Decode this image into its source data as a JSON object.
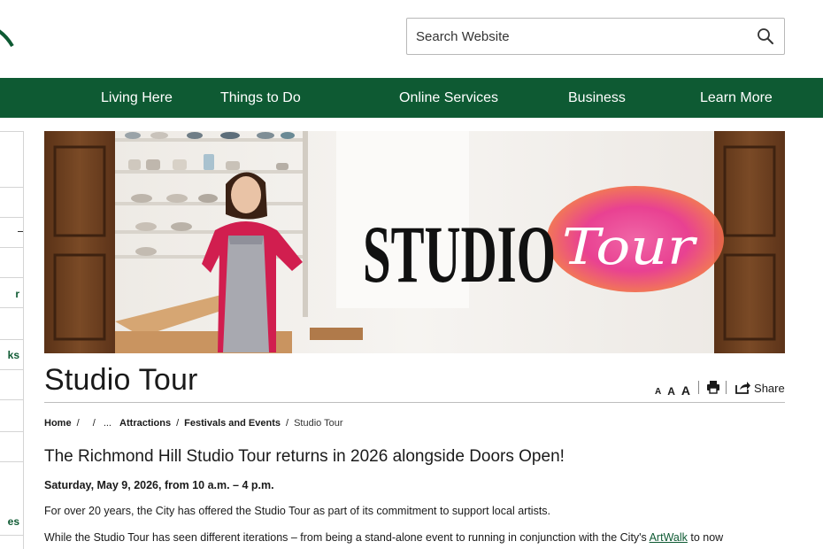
{
  "search": {
    "placeholder": "Search Website"
  },
  "nav": {
    "items": [
      {
        "label": "Living Here"
      },
      {
        "label": "Things to Do"
      },
      {
        "label": "Online Services"
      },
      {
        "label": "Business"
      },
      {
        "label": "Learn More"
      }
    ]
  },
  "sidebar": {
    "fragments": [
      "r",
      "ks",
      "es"
    ]
  },
  "hero": {
    "text_studio": "STUDIO",
    "text_tour": "Tour"
  },
  "page": {
    "title": "Studio Tour"
  },
  "tools": {
    "font_small": "A",
    "font_medium": "A",
    "font_large": "A",
    "share_label": "Share"
  },
  "breadcrumb": {
    "home": "Home",
    "sep": "/",
    "ellipsis": "...",
    "attractions": "Attractions",
    "festivals": "Festivals and Events",
    "current": "Studio Tour"
  },
  "content": {
    "heading": "The Richmond Hill Studio Tour returns in 2026 alongside Doors Open!",
    "date": "Saturday, May 9, 2026, from 10 a.m. – 4 p.m.",
    "para1": "For over 20 years, the City has offered the Studio Tour as part of its commitment to support local artists.",
    "para2_start": "While the Studio Tour has seen different iterations – from being a stand-alone event to running in conjunction with the City's ",
    "para2_link": "ArtWalk",
    "para2_end": " to now"
  },
  "colors": {
    "brand_green": "#0e5a33",
    "hero_pink": "#e8328a",
    "hero_orange": "#f47a3c"
  }
}
